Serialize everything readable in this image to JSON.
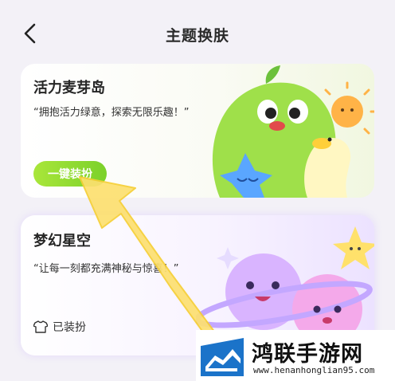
{
  "header": {
    "title": "主题换肤"
  },
  "themes": [
    {
      "name": "活力麦芽岛",
      "slogan": "“拥抱活力绿意，探索无限乐趣！”",
      "action_label": "一键装扮",
      "accent": "#8fd92f"
    },
    {
      "name": "梦幻星空",
      "slogan": "“让每一刻都充满神秘与惊喜！”",
      "status_label": "已装扮",
      "accent": "#c9a7ff"
    }
  ],
  "watermark": {
    "name": "鸿联手游网",
    "url": "www.henanhonglian95.com"
  },
  "icons": [
    "back-chevron-icon",
    "shirt-icon"
  ],
  "annotation_arrow_color": "#fde070"
}
